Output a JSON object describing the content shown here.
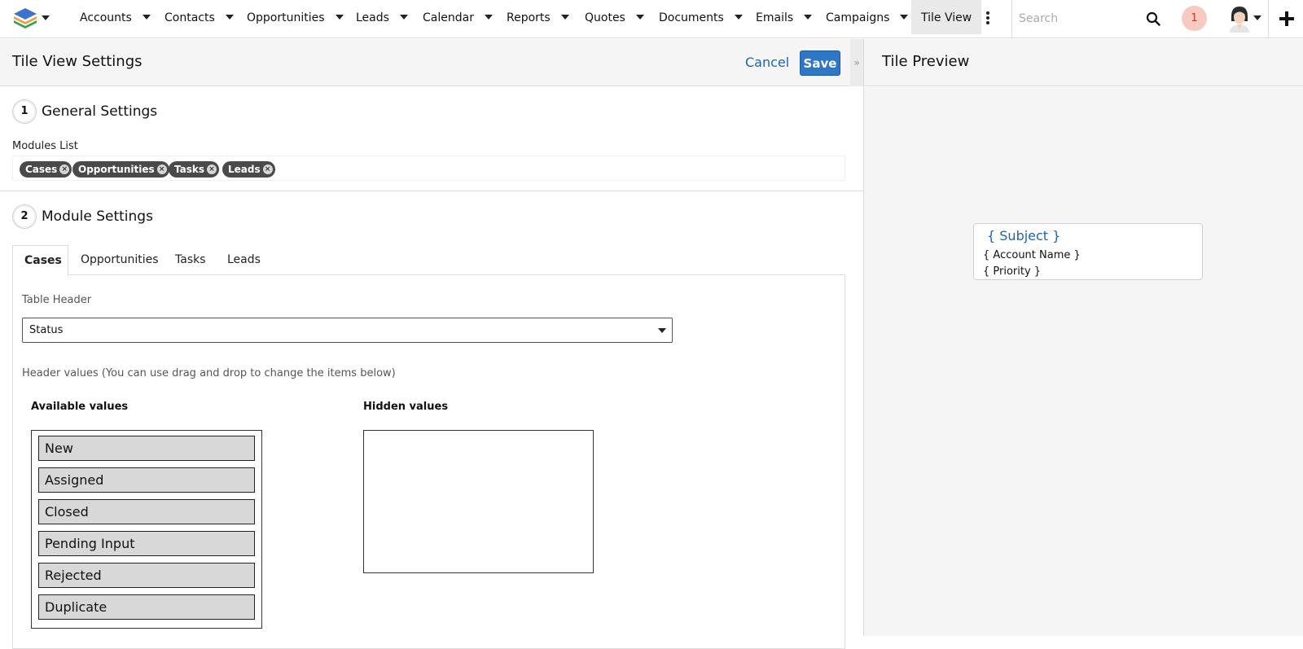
{
  "nav": {
    "items": [
      {
        "label": "Accounts"
      },
      {
        "label": "Contacts"
      },
      {
        "label": "Opportunities"
      },
      {
        "label": "Leads"
      },
      {
        "label": "Calendar"
      },
      {
        "label": "Reports"
      },
      {
        "label": "Quotes"
      },
      {
        "label": "Documents"
      },
      {
        "label": "Emails"
      },
      {
        "label": "Campaigns"
      }
    ],
    "active_item": "Tile View",
    "search_placeholder": "Search",
    "notification_count": "1"
  },
  "settings": {
    "title": "Tile View Settings",
    "cancel_label": "Cancel",
    "save_label": "Save",
    "general": {
      "step": "1",
      "title": "General Settings",
      "modules_label": "Modules List",
      "modules": [
        "Cases",
        "Opportunities",
        "Tasks",
        "Leads"
      ]
    },
    "module": {
      "step": "2",
      "title": "Module Settings",
      "tabs": [
        "Cases",
        "Opportunities",
        "Tasks",
        "Leads"
      ],
      "active_tab": "Cases",
      "table_header_label": "Table Header",
      "table_header_value": "Status",
      "header_values_hint": "Header values (You can use drag and drop to change the items below)",
      "available_title": "Available values",
      "hidden_title": "Hidden values",
      "available_values": [
        "New",
        "Assigned",
        "Closed",
        "Pending Input",
        "Rejected",
        "Duplicate"
      ],
      "hidden_values": []
    }
  },
  "preview": {
    "title": "Tile Preview",
    "tile": {
      "subject": "{ Subject }",
      "account": "{ Account Name }",
      "priority": "{ Priority }"
    }
  },
  "colors": {
    "accent": "#2e76c6",
    "link": "#1a64b4",
    "chip": "#4a4a4a",
    "notification_bg": "#f7c9c0"
  }
}
